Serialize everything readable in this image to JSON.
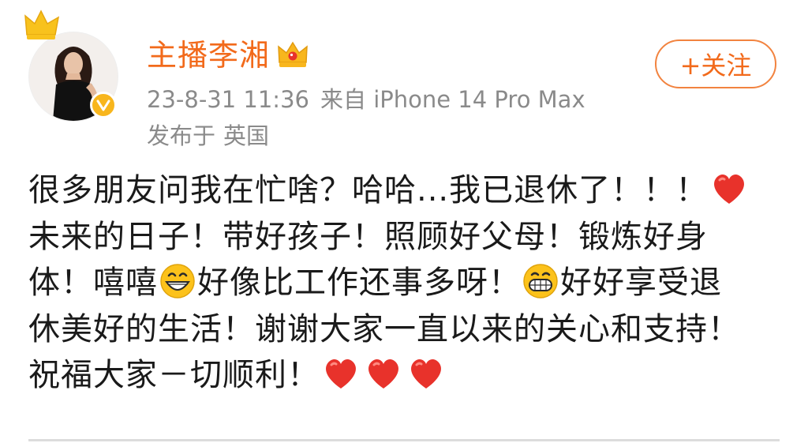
{
  "header": {
    "username": "主播李湘",
    "timestamp": "23-8-31 11:36",
    "source": "来自 iPhone 14 Pro Max",
    "location_prefix": "发布于",
    "location": "英国",
    "follow_label": "+关注"
  },
  "post": {
    "line1": {
      "text": "很多朋友问我在忙啥？哈哈...我已退休了！！！"
    },
    "line2": {
      "text": "未来的日子！带好孩子！照顾好父母！锻炼好身"
    },
    "line3": {
      "part1": "体！嘻嘻",
      "part2": "好像比工作还事多呀！",
      "part3": "好好享受退"
    },
    "line4": {
      "text": "休美好的生活！谢谢大家一直以来的关心和支持！"
    },
    "line5": {
      "text": "祝福大家－切顺利！"
    }
  },
  "icons": {
    "verified": "verified-badge-icon",
    "member": "crown-icon",
    "emoji1": "grinning-face-icon",
    "emoji2": "big-grin-icon",
    "heart": "red-heart-icon"
  },
  "colors": {
    "accent": "#f26a1b",
    "meta": "#8a8a8a",
    "badge": "#f8b61d",
    "heart": "#e8322b",
    "text": "#1a1a1a"
  }
}
